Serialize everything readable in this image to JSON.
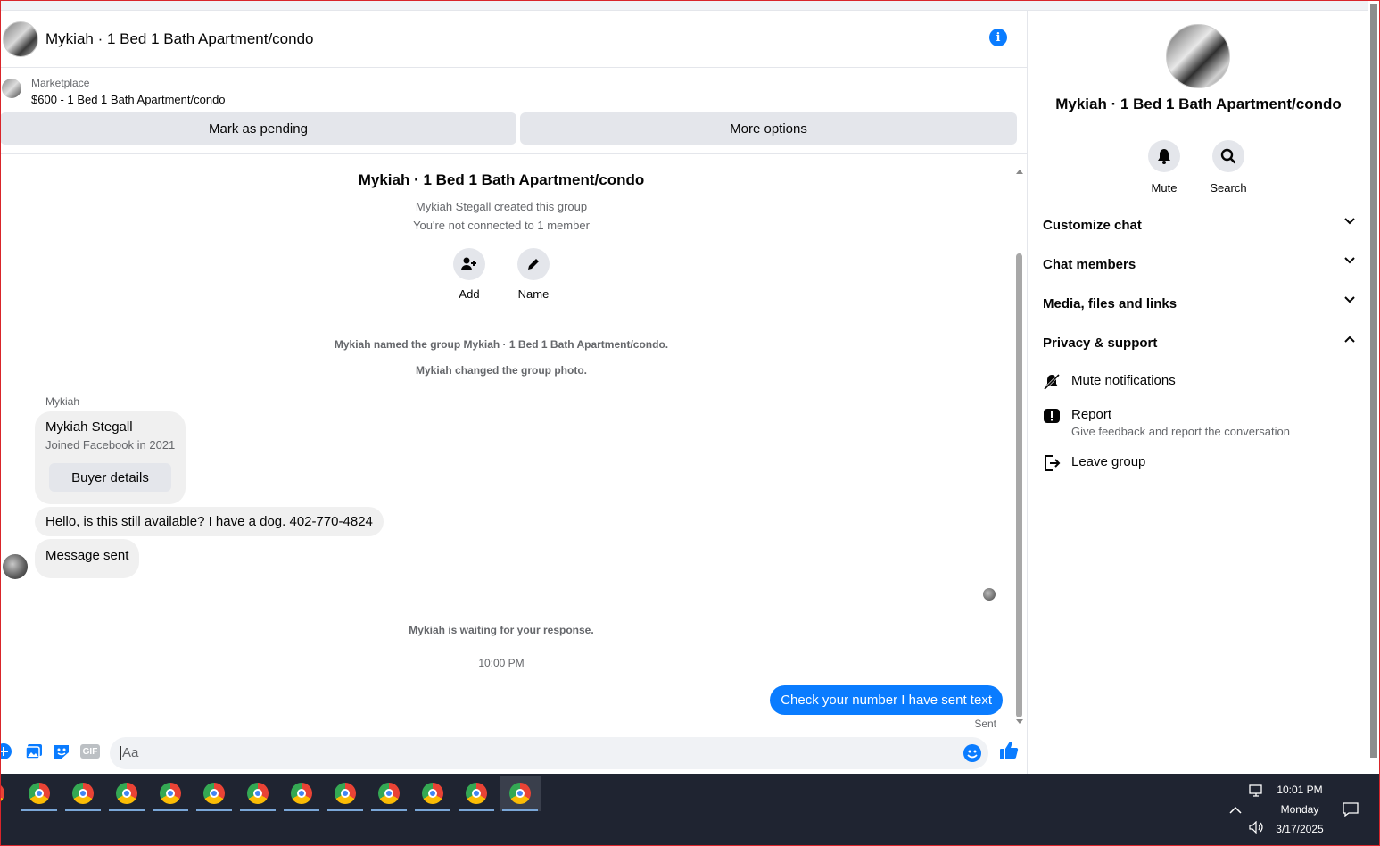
{
  "header": {
    "title": "Mykiah · 1 Bed 1 Bath Apartment/condo"
  },
  "marketplace": {
    "label": "Marketplace",
    "listing": "$600 - 1 Bed 1 Bath Apartment/condo",
    "mark_pending": "Mark as pending",
    "more_options": "More options"
  },
  "thread": {
    "group_title": "Mykiah · 1 Bed 1 Bath Apartment/condo",
    "created": "Mykiah Stegall created this group",
    "connection": "You're not connected to 1 member",
    "actions": {
      "add": "Add",
      "name": "Name"
    },
    "system_msgs": [
      "Mykiah named the group Mykiah · 1 Bed 1 Bath Apartment/condo.",
      "Mykiah changed the group photo."
    ],
    "sender_name": "Mykiah",
    "card": {
      "name": "Mykiah Stegall",
      "joined": "Joined Facebook in 2021",
      "button": "Buyer details"
    },
    "incoming": [
      "Hello, is this still available? I have a dog. 402-770-4824",
      "Message sent"
    ],
    "waiting": "Mykiah is waiting for your response.",
    "timestamp": "10:00 PM",
    "outgoing": "Check your number I have sent text",
    "status": "Sent"
  },
  "composer": {
    "placeholder": "Aa",
    "gif_label": "GIF"
  },
  "panel": {
    "title": "Mykiah · 1 Bed 1 Bath Apartment/condo",
    "actions": {
      "mute": "Mute",
      "search": "Search"
    },
    "sections": [
      "Customize chat",
      "Chat members",
      "Media, files and links",
      "Privacy & support"
    ],
    "options": {
      "mute_notifications": "Mute notifications",
      "report": "Report",
      "report_desc": "Give feedback and report the conversation",
      "leave": "Leave group"
    }
  },
  "taskbar": {
    "time": "10:01 PM",
    "day": "Monday",
    "date": "3/17/2025"
  },
  "colors": {
    "accent": "#0a7cff",
    "bubble_in": "#f0f0f0",
    "taskbar": "#1f2431"
  }
}
